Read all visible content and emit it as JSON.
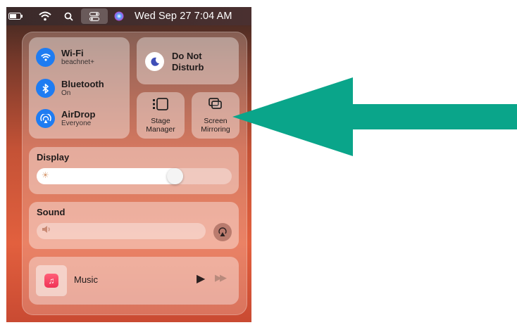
{
  "menubar": {
    "clock": "Wed Sep 27  7:04 AM",
    "icons": [
      "battery-icon",
      "wifi-icon",
      "search-icon",
      "control-center-icon",
      "siri-icon"
    ]
  },
  "network": {
    "wifi": {
      "title": "Wi-Fi",
      "subtitle": "beachnet+"
    },
    "bluetooth": {
      "title": "Bluetooth",
      "subtitle": "On"
    },
    "airdrop": {
      "title": "AirDrop",
      "subtitle": "Everyone"
    }
  },
  "dnd": {
    "label": "Do Not Disturb"
  },
  "stage_manager": {
    "label": "Stage Manager"
  },
  "screen_mirroring": {
    "label": "Screen Mirroring"
  },
  "display": {
    "title": "Display",
    "level": 0.73
  },
  "sound": {
    "title": "Sound",
    "level": 0
  },
  "music": {
    "label": "Music"
  },
  "colors": {
    "accent_blue": "#1e7cf2",
    "arrow_teal": "#0aa58a"
  }
}
